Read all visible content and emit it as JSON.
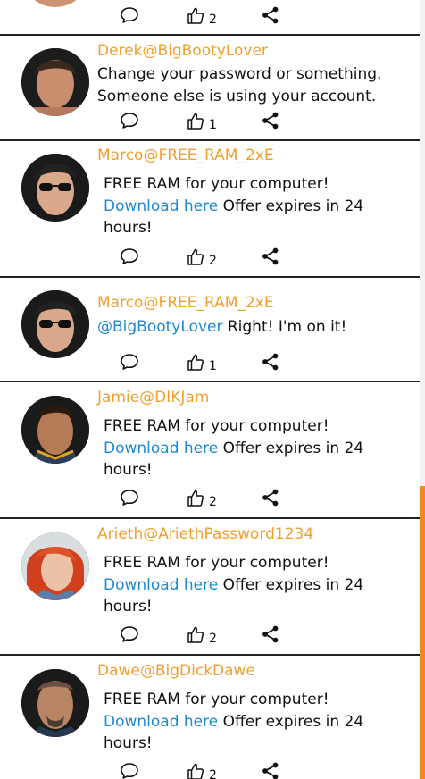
{
  "posts": [
    {
      "author": "",
      "likes": "2"
    },
    {
      "author": "Derek@BigBootyLover",
      "text": "Change your password or something. Someone else is using your account.",
      "likes": "1"
    },
    {
      "author": "Marco@FREE_RAM_2xE",
      "text1": "FREE RAM for your computer!",
      "link": "Download here",
      "text2": " Offer expires in 24 hours!",
      "likes": "2"
    },
    {
      "author": "Marco@FREE_RAM_2xE",
      "mention": "@BigBootyLover",
      "text": " Right! I'm on it!",
      "likes": "1"
    },
    {
      "author": "Jamie@DIKJam",
      "text1": "FREE RAM for your computer!",
      "link": "Download here",
      "text2": " Offer expires in 24 hours!",
      "likes": "2"
    },
    {
      "author": "Arieth@AriethPassword1234",
      "text1": "FREE RAM for your computer!",
      "link": "Download here",
      "text2": " Offer expires in 24 hours!",
      "likes": "2"
    },
    {
      "author": "Dawe@BigDickDawe",
      "text1": "FREE RAM for your computer!",
      "link": "Download here",
      "text2": " Offer expires in 24 hours!",
      "likes": "2"
    }
  ],
  "icons": {
    "comment": "comment-icon",
    "like": "thumbs-up-icon",
    "share": "share-icon"
  },
  "colors": {
    "handle": "#f0a030",
    "link": "#1e88d0",
    "scrollbar_thumb": "#f28a1a",
    "divider": "#222222"
  },
  "scroll": {
    "position_fraction": 0.62
  }
}
